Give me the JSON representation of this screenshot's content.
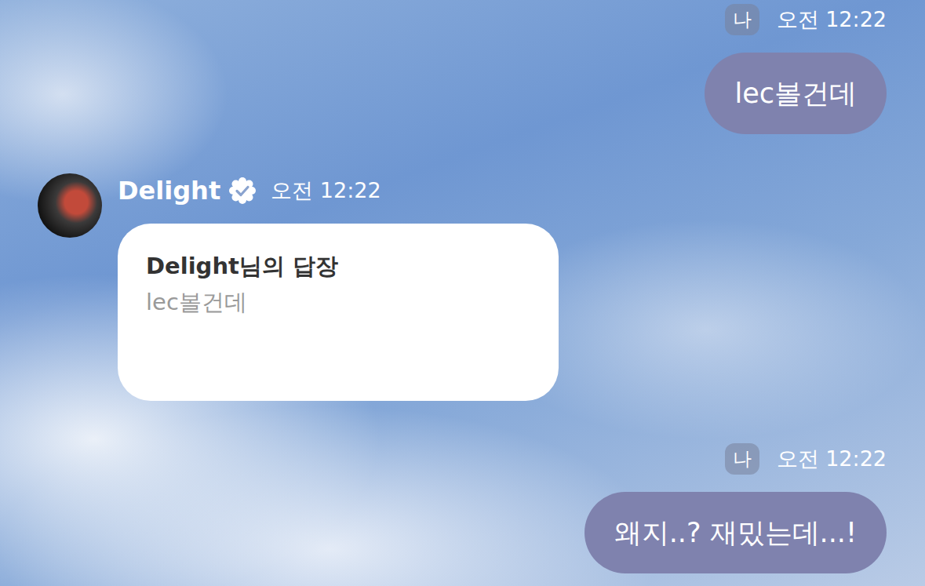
{
  "messages": [
    {
      "kind": "mine",
      "sender": "나",
      "time": "오전 12:22",
      "text": "lec볼건데"
    },
    {
      "kind": "reply",
      "sender": "Delight",
      "verified": true,
      "time": "오전 12:22",
      "reply_title": "Delight님의 답장",
      "reply_quote": "lec볼건데"
    },
    {
      "kind": "mine",
      "sender": "나",
      "time": "오전 12:22",
      "text": "왜지..? 재밌는데...!"
    }
  ]
}
